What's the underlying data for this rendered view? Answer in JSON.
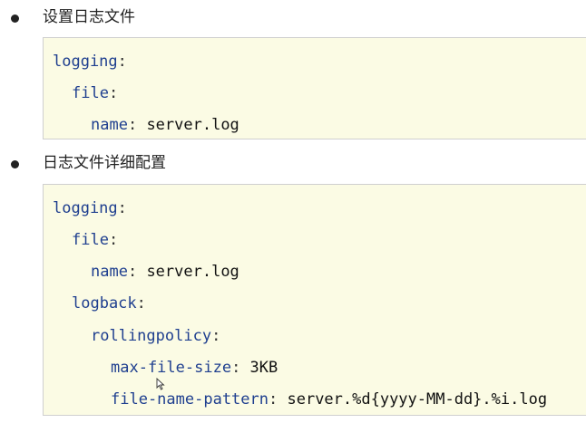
{
  "sections": [
    {
      "heading": "设置日志文件",
      "lines": [
        {
          "key": "logging",
          "value": ""
        },
        {
          "key": "file",
          "value": ""
        },
        {
          "key": "name",
          "value": "server.log"
        }
      ]
    },
    {
      "heading": "日志文件详细配置",
      "lines": [
        {
          "key": "logging",
          "value": ""
        },
        {
          "key": "file",
          "value": ""
        },
        {
          "key": "name",
          "value": "server.log"
        },
        {
          "key": "logback",
          "value": ""
        },
        {
          "key": "rollingpolicy",
          "value": ""
        },
        {
          "key": "max-file-size",
          "value": "3KB"
        },
        {
          "key": "file-name-pattern",
          "value": "server.%d{yyyy-MM-dd}.%i.log"
        }
      ]
    }
  ],
  "colors": {
    "code_background": "#fbfbe4",
    "key_color": "#1f3f8f"
  },
  "icons": {
    "cursor": "mouse-pointer-icon"
  }
}
